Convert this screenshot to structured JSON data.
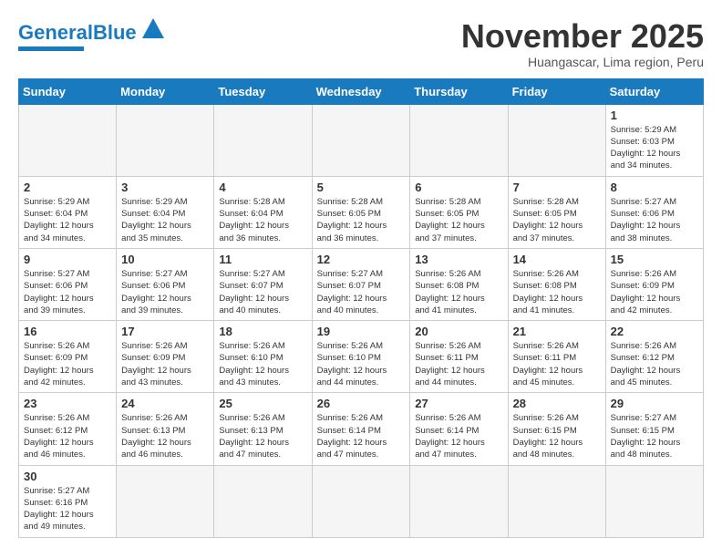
{
  "header": {
    "logo_general": "General",
    "logo_blue": "Blue",
    "month_title": "November 2025",
    "subtitle": "Huangascar, Lima region, Peru"
  },
  "days_of_week": [
    "Sunday",
    "Monday",
    "Tuesday",
    "Wednesday",
    "Thursday",
    "Friday",
    "Saturday"
  ],
  "weeks": [
    [
      {
        "day": "",
        "info": ""
      },
      {
        "day": "",
        "info": ""
      },
      {
        "day": "",
        "info": ""
      },
      {
        "day": "",
        "info": ""
      },
      {
        "day": "",
        "info": ""
      },
      {
        "day": "",
        "info": ""
      },
      {
        "day": "1",
        "info": "Sunrise: 5:29 AM\nSunset: 6:03 PM\nDaylight: 12 hours\nand 34 minutes."
      }
    ],
    [
      {
        "day": "2",
        "info": "Sunrise: 5:29 AM\nSunset: 6:04 PM\nDaylight: 12 hours\nand 34 minutes."
      },
      {
        "day": "3",
        "info": "Sunrise: 5:29 AM\nSunset: 6:04 PM\nDaylight: 12 hours\nand 35 minutes."
      },
      {
        "day": "4",
        "info": "Sunrise: 5:28 AM\nSunset: 6:04 PM\nDaylight: 12 hours\nand 36 minutes."
      },
      {
        "day": "5",
        "info": "Sunrise: 5:28 AM\nSunset: 6:05 PM\nDaylight: 12 hours\nand 36 minutes."
      },
      {
        "day": "6",
        "info": "Sunrise: 5:28 AM\nSunset: 6:05 PM\nDaylight: 12 hours\nand 37 minutes."
      },
      {
        "day": "7",
        "info": "Sunrise: 5:28 AM\nSunset: 6:05 PM\nDaylight: 12 hours\nand 37 minutes."
      },
      {
        "day": "8",
        "info": "Sunrise: 5:27 AM\nSunset: 6:06 PM\nDaylight: 12 hours\nand 38 minutes."
      }
    ],
    [
      {
        "day": "9",
        "info": "Sunrise: 5:27 AM\nSunset: 6:06 PM\nDaylight: 12 hours\nand 39 minutes."
      },
      {
        "day": "10",
        "info": "Sunrise: 5:27 AM\nSunset: 6:06 PM\nDaylight: 12 hours\nand 39 minutes."
      },
      {
        "day": "11",
        "info": "Sunrise: 5:27 AM\nSunset: 6:07 PM\nDaylight: 12 hours\nand 40 minutes."
      },
      {
        "day": "12",
        "info": "Sunrise: 5:27 AM\nSunset: 6:07 PM\nDaylight: 12 hours\nand 40 minutes."
      },
      {
        "day": "13",
        "info": "Sunrise: 5:26 AM\nSunset: 6:08 PM\nDaylight: 12 hours\nand 41 minutes."
      },
      {
        "day": "14",
        "info": "Sunrise: 5:26 AM\nSunset: 6:08 PM\nDaylight: 12 hours\nand 41 minutes."
      },
      {
        "day": "15",
        "info": "Sunrise: 5:26 AM\nSunset: 6:09 PM\nDaylight: 12 hours\nand 42 minutes."
      }
    ],
    [
      {
        "day": "16",
        "info": "Sunrise: 5:26 AM\nSunset: 6:09 PM\nDaylight: 12 hours\nand 42 minutes."
      },
      {
        "day": "17",
        "info": "Sunrise: 5:26 AM\nSunset: 6:09 PM\nDaylight: 12 hours\nand 43 minutes."
      },
      {
        "day": "18",
        "info": "Sunrise: 5:26 AM\nSunset: 6:10 PM\nDaylight: 12 hours\nand 43 minutes."
      },
      {
        "day": "19",
        "info": "Sunrise: 5:26 AM\nSunset: 6:10 PM\nDaylight: 12 hours\nand 44 minutes."
      },
      {
        "day": "20",
        "info": "Sunrise: 5:26 AM\nSunset: 6:11 PM\nDaylight: 12 hours\nand 44 minutes."
      },
      {
        "day": "21",
        "info": "Sunrise: 5:26 AM\nSunset: 6:11 PM\nDaylight: 12 hours\nand 45 minutes."
      },
      {
        "day": "22",
        "info": "Sunrise: 5:26 AM\nSunset: 6:12 PM\nDaylight: 12 hours\nand 45 minutes."
      }
    ],
    [
      {
        "day": "23",
        "info": "Sunrise: 5:26 AM\nSunset: 6:12 PM\nDaylight: 12 hours\nand 46 minutes."
      },
      {
        "day": "24",
        "info": "Sunrise: 5:26 AM\nSunset: 6:13 PM\nDaylight: 12 hours\nand 46 minutes."
      },
      {
        "day": "25",
        "info": "Sunrise: 5:26 AM\nSunset: 6:13 PM\nDaylight: 12 hours\nand 47 minutes."
      },
      {
        "day": "26",
        "info": "Sunrise: 5:26 AM\nSunset: 6:14 PM\nDaylight: 12 hours\nand 47 minutes."
      },
      {
        "day": "27",
        "info": "Sunrise: 5:26 AM\nSunset: 6:14 PM\nDaylight: 12 hours\nand 47 minutes."
      },
      {
        "day": "28",
        "info": "Sunrise: 5:26 AM\nSunset: 6:15 PM\nDaylight: 12 hours\nand 48 minutes."
      },
      {
        "day": "29",
        "info": "Sunrise: 5:27 AM\nSunset: 6:15 PM\nDaylight: 12 hours\nand 48 minutes."
      }
    ],
    [
      {
        "day": "30",
        "info": "Sunrise: 5:27 AM\nSunset: 6:16 PM\nDaylight: 12 hours\nand 49 minutes."
      },
      {
        "day": "",
        "info": ""
      },
      {
        "day": "",
        "info": ""
      },
      {
        "day": "",
        "info": ""
      },
      {
        "day": "",
        "info": ""
      },
      {
        "day": "",
        "info": ""
      },
      {
        "day": "",
        "info": ""
      }
    ]
  ]
}
